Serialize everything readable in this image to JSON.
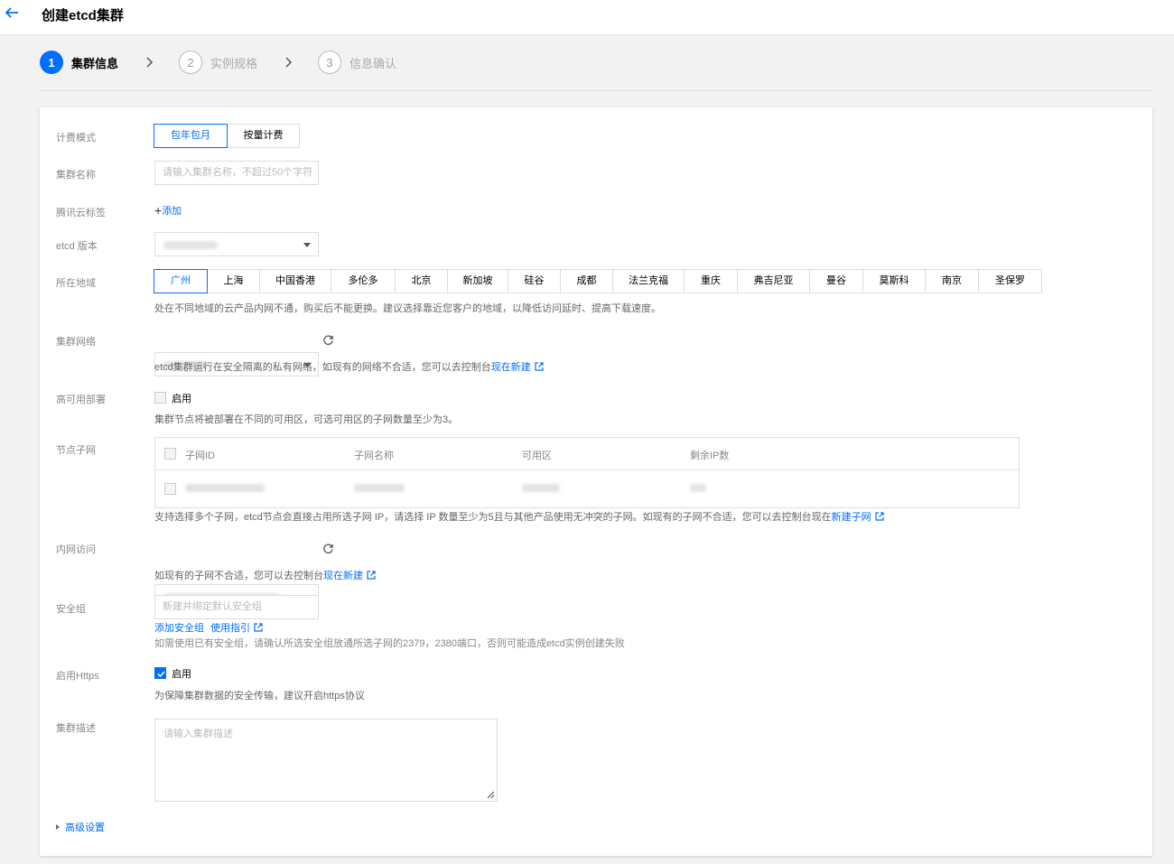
{
  "page": {
    "title": "创建etcd集群"
  },
  "steps": [
    {
      "num": "1",
      "label": "集群信息"
    },
    {
      "num": "2",
      "label": "实例规格"
    },
    {
      "num": "3",
      "label": "信息确认"
    }
  ],
  "billing": {
    "label": "计费模式",
    "options": [
      "包年包月",
      "按量计费"
    ]
  },
  "cluster_name": {
    "label": "集群名称",
    "placeholder": "请输入集群名称，不超过50个字符"
  },
  "tags": {
    "label": "腾讯云标签",
    "add": "添加"
  },
  "version": {
    "label": "etcd 版本"
  },
  "region": {
    "label": "所在地域",
    "options": [
      "广州",
      "上海",
      "中国香港",
      "多伦多",
      "北京",
      "新加坡",
      "硅谷",
      "成都",
      "法兰克福",
      "重庆",
      "弗吉尼亚",
      "曼谷",
      "莫斯科",
      "南京",
      "圣保罗"
    ],
    "hint": "处在不同地域的云产品内网不通，购买后不能更换。建议选择靠近您客户的地域，以降低访问延时、提高下载速度。"
  },
  "network": {
    "label": "集群网络",
    "hint_prefix": "etcd集群运行在安全隔离的私有网络，如现有的网络不合适，您可以去控制台",
    "hint_link": "现在新建"
  },
  "ha": {
    "label": "高可用部署",
    "option": "启用",
    "hint": "集群节点将被部署在不同的可用区，可选可用区的子网数量至少为3。"
  },
  "subnet": {
    "label": "节点子网",
    "columns": [
      "子网ID",
      "子网名称",
      "可用区",
      "剩余IP数"
    ],
    "hint_prefix": "支持选择多个子网，etcd节点会直接占用所选子网 IP，请选择 IP 数量至少为5且与其他产品使用无冲突的子网。如现有的子网不合适，您可以去控制台现在",
    "hint_link": "新建子网"
  },
  "intranet": {
    "label": "内网访问",
    "hint_prefix": "如现有的子网不合适，您可以去控制台",
    "hint_link": "现在新建"
  },
  "security_group": {
    "label": "安全组",
    "placeholder": "新建并绑定默认安全组",
    "link_add": "添加安全组",
    "link_guide": "使用指引",
    "hint": "如需使用已有安全组，请确认所选安全组放通所选子网的2379，2380端口，否则可能造成etcd实例创建失败"
  },
  "https": {
    "label": "启用Https",
    "option": "启用",
    "hint": "为保障集群数据的安全传输，建议开启https协议"
  },
  "description": {
    "label": "集群描述",
    "placeholder": "请输入集群描述"
  },
  "advanced": {
    "label": "高级设置"
  },
  "colors": {
    "accent": "#006eff"
  }
}
